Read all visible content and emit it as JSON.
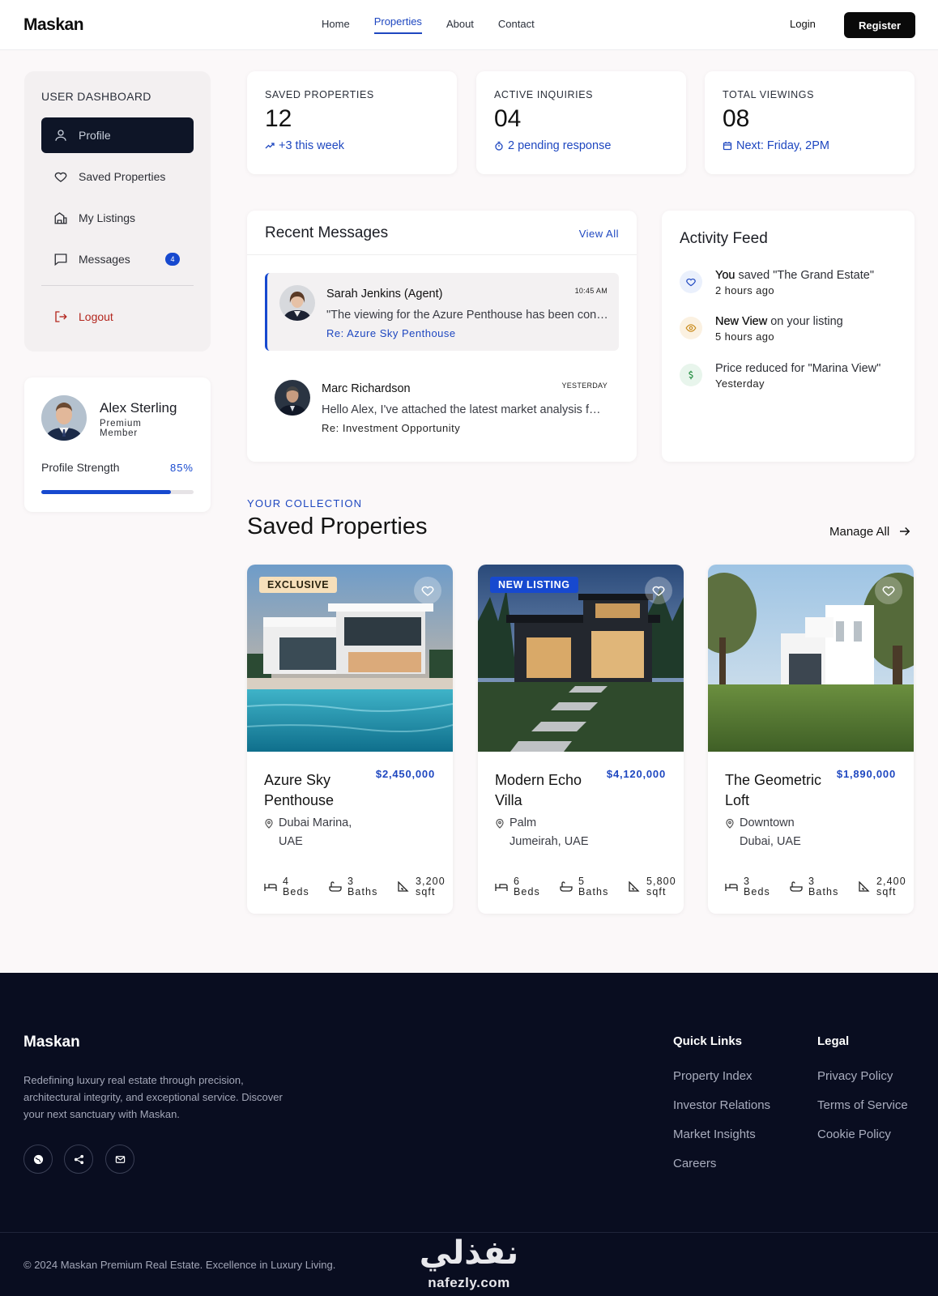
{
  "nav": {
    "brand": "Maskan",
    "links": [
      "Home",
      "Properties",
      "About",
      "Contact"
    ],
    "active_link": "Properties",
    "login": "Login",
    "register": "Register"
  },
  "sidebar": {
    "heading": "USER DASHBOARD",
    "items": [
      {
        "label": "Profile",
        "icon": "user-icon",
        "active": true
      },
      {
        "label": "Saved Properties",
        "icon": "heart-icon"
      },
      {
        "label": "My Listings",
        "icon": "buildings-icon"
      },
      {
        "label": "Messages",
        "icon": "chat-icon",
        "badge": "4"
      }
    ],
    "logout": "Logout"
  },
  "profile": {
    "name": "Alex Sterling",
    "tier": "Premium Member",
    "strength_label": "Profile Strength",
    "strength_pct": "85%",
    "strength_value": 0.85
  },
  "stats": [
    {
      "label": "SAVED PROPERTIES",
      "value": "12",
      "note": "+3 this week",
      "icon": "trend-up-icon"
    },
    {
      "label": "ACTIVE INQUIRIES",
      "value": "04",
      "note": "2 pending response",
      "icon": "timer-icon"
    },
    {
      "label": "TOTAL VIEWINGS",
      "value": "08",
      "note": "Next: Friday, 2PM",
      "icon": "calendar-icon"
    }
  ],
  "messages": {
    "title": "Recent Messages",
    "view_all": "View All",
    "items": [
      {
        "name": "Sarah Jenkins (Agent)",
        "time": "10:45 AM",
        "body": "\"The viewing for the Azure Penthouse has been confirmed for Friday...\"",
        "re": "Re: Azure Sky Penthouse"
      },
      {
        "name": "Marc Richardson",
        "time": "YESTERDAY",
        "body": "Hello Alex, I've attached the latest market analysis for the Palm region...",
        "re": "Re: Investment Opportunity"
      }
    ]
  },
  "activity": {
    "title": "Activity Feed",
    "items": [
      {
        "bold": "You",
        "text": " saved \"The Grand Estate\"",
        "time": "2 hours ago",
        "icon": "heart-icon"
      },
      {
        "bold": "New View",
        "text": " on your listing",
        "time": "5 hours ago",
        "icon": "eye-icon"
      },
      {
        "bold": "",
        "text": "Price reduced for \"Marina View\"",
        "time": "Yesterday",
        "icon": "dollar-icon"
      }
    ]
  },
  "collection": {
    "kicker": "YOUR COLLECTION",
    "title": "Saved Properties",
    "manage_all": "Manage All",
    "properties": [
      {
        "tag": "EXCLUSIVE",
        "name": "Azure Sky Penthouse",
        "price": "$2,450,000",
        "location": "Dubai Marina, UAE",
        "beds": "4 Beds",
        "baths": "3 Baths",
        "area": "3,200 sqft"
      },
      {
        "tag": "NEW LISTING",
        "name": "Modern Echo Villa",
        "price": "$4,120,000",
        "location": "Palm Jumeirah, UAE",
        "beds": "6 Beds",
        "baths": "5 Baths",
        "area": "5,800 sqft"
      },
      {
        "tag": "",
        "name": "The Geometric Loft",
        "price": "$1,890,000",
        "location": "Downtown Dubai, UAE",
        "beds": "3 Beds",
        "baths": "3 Baths",
        "area": "2,400 sqft"
      }
    ]
  },
  "footer": {
    "brand": "Maskan",
    "description": "Redefining luxury real estate through precision, architectural integrity, and exceptional service. Discover your next sanctuary with Maskan.",
    "quick_links_title": "Quick Links",
    "quick_links": [
      "Property Index",
      "Investor Relations",
      "Market Insights",
      "Careers"
    ],
    "legal_title": "Legal",
    "legal": [
      "Privacy Policy",
      "Terms of Service",
      "Cookie Policy"
    ],
    "copyright": "© 2024 Maskan Premium Real Estate. Excellence in Luxury Living.",
    "social": [
      "globe-icon",
      "share-icon",
      "mail-icon"
    ]
  },
  "watermark": {
    "arabic": "نفذلي",
    "latin": "nafezly.com"
  },
  "colors": {
    "accent": "#1749cf",
    "dark": "#0e1527",
    "footer_bg": "#090d20",
    "logout": "#b3261e",
    "tag_exclusive": "#f6dfba"
  }
}
